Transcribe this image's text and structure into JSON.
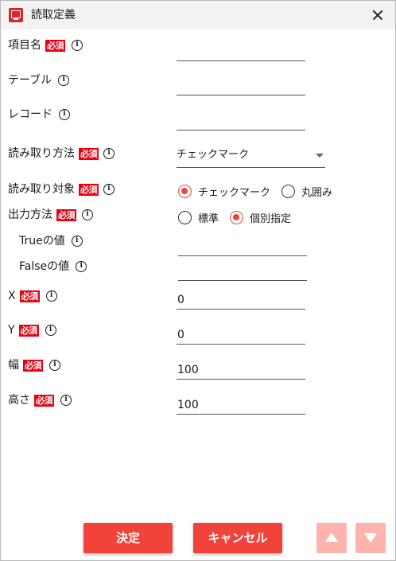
{
  "window": {
    "title": "読取定義"
  },
  "required_tag": "必須",
  "info_glyph": "i",
  "fields": {
    "item_name": {
      "label": "項目名",
      "value": ""
    },
    "table": {
      "label": "テーブル",
      "value": ""
    },
    "record": {
      "label": "レコード",
      "value": ""
    },
    "read_method": {
      "label": "読み取り方法",
      "selected": "チェックマーク"
    },
    "read_target": {
      "label": "読み取り対象",
      "options": [
        "チェックマーク",
        "丸囲み"
      ],
      "selected": "チェックマーク"
    },
    "output_method": {
      "label": "出力方法",
      "options": [
        "標準",
        "個別指定"
      ],
      "selected": "個別指定"
    },
    "true_value": {
      "label": "Trueの値",
      "value": ""
    },
    "false_value": {
      "label": "Falseの値",
      "value": ""
    },
    "x": {
      "label": "X",
      "value": "0"
    },
    "y": {
      "label": "Y",
      "value": "0"
    },
    "width": {
      "label": "幅",
      "value": "100"
    },
    "height": {
      "label": "高さ",
      "value": "100"
    }
  },
  "buttons": {
    "ok": "決定",
    "cancel": "キャンセル"
  },
  "colors": {
    "accent": "#f2433a",
    "required_bg": "#e60012",
    "radio_on": "#e8473f",
    "disabled_arrow": "#ffb3af"
  }
}
